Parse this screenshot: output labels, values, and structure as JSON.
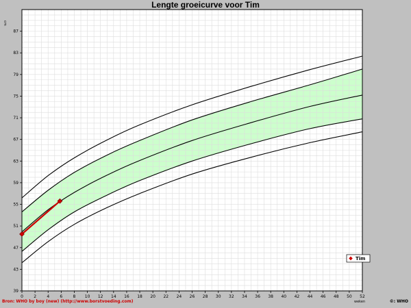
{
  "chart_data": {
    "type": "line",
    "title": "Lengte groeicurve voor Tim",
    "ylabel": "cm",
    "xlabel": "weken",
    "xlim": [
      0,
      52
    ],
    "ylim": [
      39,
      91
    ],
    "x_ticks": [
      0,
      2,
      4,
      6,
      8,
      10,
      12,
      14,
      16,
      18,
      20,
      22,
      24,
      26,
      28,
      30,
      32,
      34,
      36,
      38,
      40,
      42,
      44,
      46,
      48,
      50,
      52
    ],
    "y_ticks": [
      39,
      43,
      47,
      51,
      55,
      59,
      63,
      67,
      71,
      75,
      79,
      83,
      87
    ],
    "grid": true,
    "legend_position": "bottom-right",
    "reference_curves": [
      {
        "x": [
          0,
          4,
          8,
          13,
          18,
          26,
          35,
          44,
          52
        ],
        "values": [
          56.2,
          60.3,
          63.6,
          66.9,
          69.7,
          73.4,
          76.8,
          79.9,
          82.4
        ]
      },
      {
        "x": [
          0,
          4,
          8,
          13,
          18,
          26,
          35,
          44,
          52
        ],
        "values": [
          53.6,
          57.6,
          60.9,
          64.1,
          66.8,
          70.6,
          74.0,
          77.1,
          80.0
        ]
      },
      {
        "x": [
          0,
          4,
          8,
          13,
          18,
          26,
          35,
          44,
          52
        ],
        "values": [
          49.9,
          54.0,
          57.2,
          60.4,
          63.1,
          66.8,
          70.1,
          73.1,
          75.2
        ]
      },
      {
        "x": [
          0,
          4,
          8,
          13,
          18,
          26,
          35,
          44,
          52
        ],
        "values": [
          46.3,
          50.3,
          53.6,
          56.7,
          59.4,
          63.0,
          66.2,
          69.0,
          70.8
        ]
      },
      {
        "x": [
          0,
          4,
          8,
          13,
          18,
          26,
          35,
          44,
          52
        ],
        "values": [
          44.2,
          48.1,
          51.3,
          54.4,
          57.0,
          60.6,
          63.7,
          66.4,
          68.4
        ]
      }
    ],
    "series": [
      {
        "name": "Tim",
        "x": [
          0,
          5.8
        ],
        "values": [
          49.5,
          55.6
        ],
        "color": "#cc0000"
      }
    ],
    "band_color": "#ccffcc"
  },
  "footer": {
    "source": "Bron: WHO by boy (new) (http://www.borstvoeding.com)",
    "copyright": "©: WHO"
  }
}
